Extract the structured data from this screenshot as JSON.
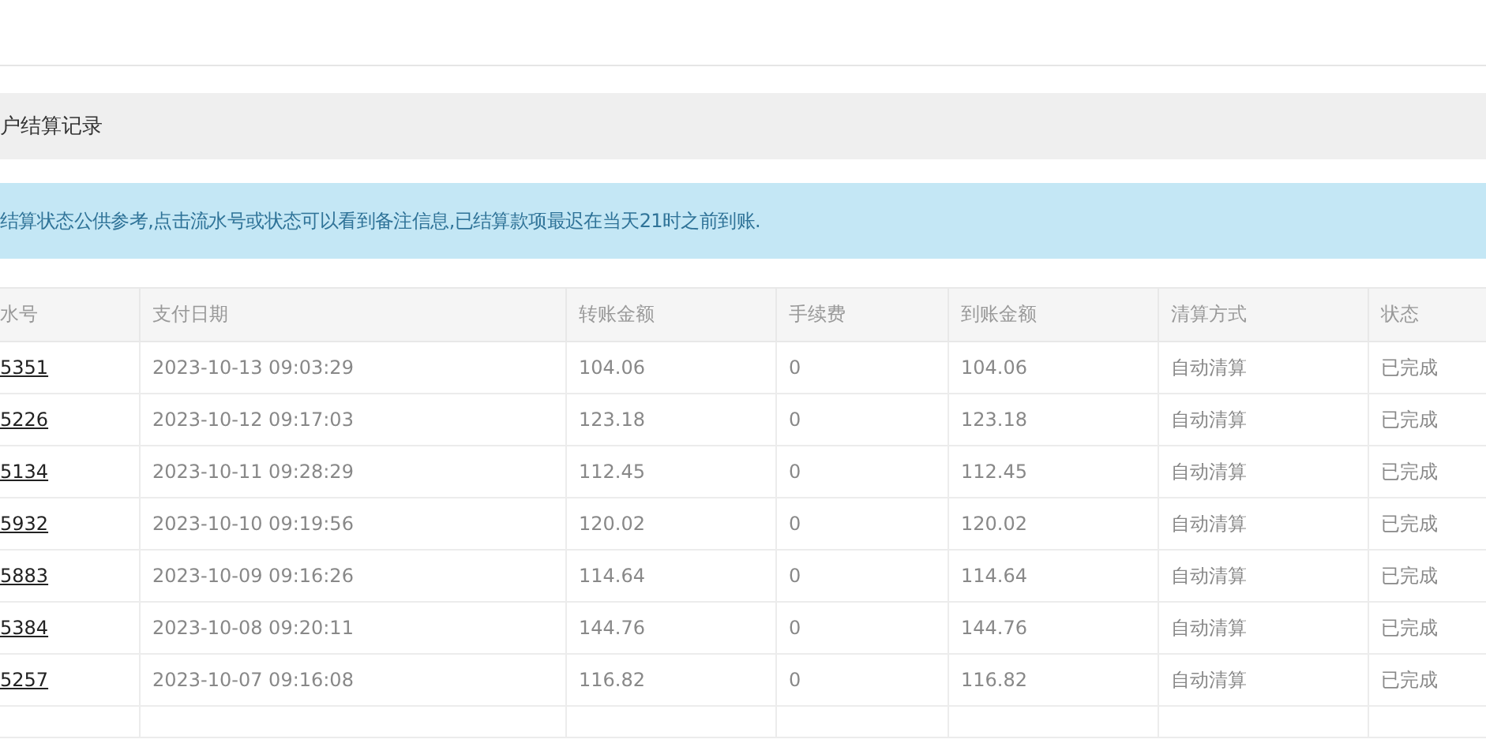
{
  "page_title": "户结算记录",
  "notice": "结算状态公供参考,点击流水号或状态可以看到备注信息,已结算款项最迟在当天21时之前到账.",
  "table": {
    "columns": [
      "水号",
      "支付日期",
      "转账金额",
      "手续费",
      "到账金额",
      "清算方式",
      "状态"
    ],
    "rows": [
      [
        "5351",
        "2023-10-13 09:03:29",
        "104.06",
        "0",
        "104.06",
        "自动清算",
        "已完成"
      ],
      [
        "5226",
        "2023-10-12 09:17:03",
        "123.18",
        "0",
        "123.18",
        "自动清算",
        "已完成"
      ],
      [
        "5134",
        "2023-10-11 09:28:29",
        "112.45",
        "0",
        "112.45",
        "自动清算",
        "已完成"
      ],
      [
        "5932",
        "2023-10-10 09:19:56",
        "120.02",
        "0",
        "120.02",
        "自动清算",
        "已完成"
      ],
      [
        "5883",
        "2023-10-09 09:16:26",
        "114.64",
        "0",
        "114.64",
        "自动清算",
        "已完成"
      ],
      [
        "5384",
        "2023-10-08 09:20:11",
        "144.76",
        "0",
        "144.76",
        "自动清算",
        "已完成"
      ],
      [
        "5257",
        "2023-10-07 09:16:08",
        "116.82",
        "0",
        "116.82",
        "自动清算",
        "已完成"
      ]
    ]
  }
}
